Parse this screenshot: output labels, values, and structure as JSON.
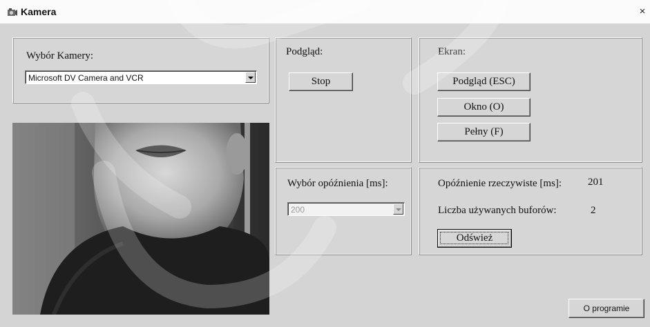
{
  "window": {
    "title": "Kamera",
    "close_glyph": "×"
  },
  "camera": {
    "label": "Wybór Kamery:",
    "selected": "Microsoft DV Camera and VCR"
  },
  "preview": {
    "label": "Podgląd:",
    "stop_button": "Stop"
  },
  "screen": {
    "label": "Ekran:",
    "preview_button": "Podgląd (ESC)",
    "window_button": "Okno (O)",
    "full_button": "Pełny (F)"
  },
  "delay": {
    "label": "Wybór opóźnienia [ms]:",
    "selected": "200"
  },
  "stats": {
    "actual_delay_label": "Opóźnienie rzeczywiste [ms]:",
    "actual_delay_value": "201",
    "buffers_label": "Liczba używanych buforów:",
    "buffers_value": "2",
    "refresh_button": "Odśwież"
  },
  "footer": {
    "about_button": "O programie"
  },
  "colors": {
    "window_bg": "#d4d4d4",
    "titlebar_bg": "#fbfbfb"
  },
  "icons": {
    "app": "camera-app-icon",
    "close": "close-icon"
  }
}
